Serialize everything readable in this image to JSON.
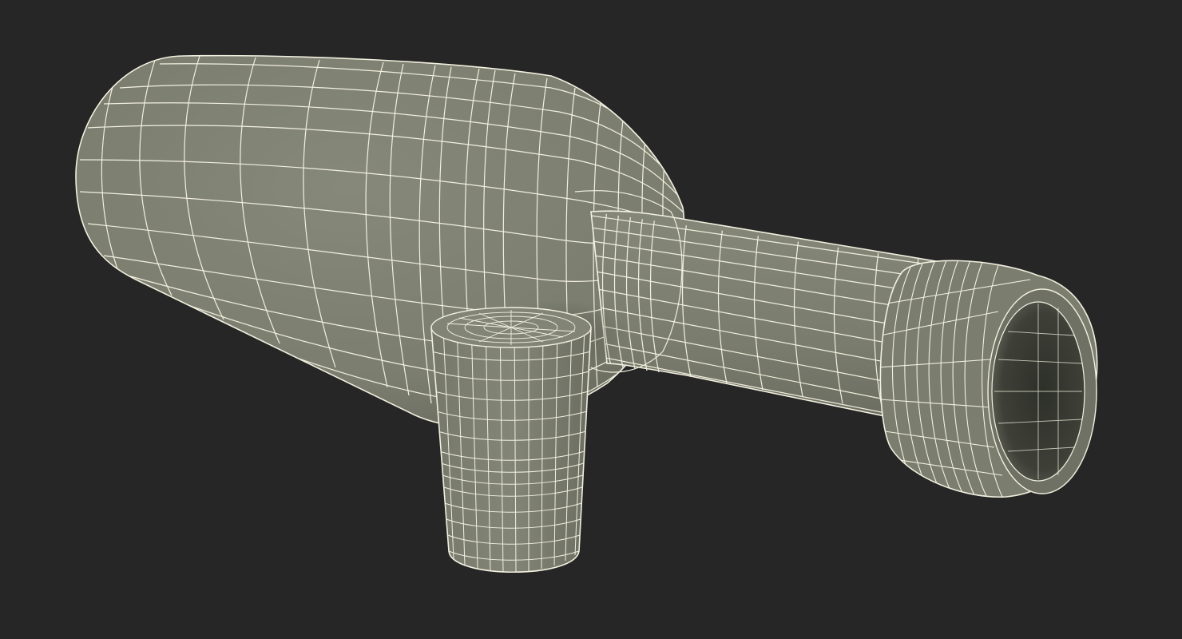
{
  "scene": {
    "subject": "wireframe-bottle-with-cork",
    "background_color": "#262626",
    "mesh_fill_color": "#7b7d6f",
    "mesh_shadow_color": "#5f6157",
    "wire_color": "#f2f0df",
    "interior_color": "#3a3c35",
    "objects": [
      "bottle",
      "cork"
    ]
  }
}
